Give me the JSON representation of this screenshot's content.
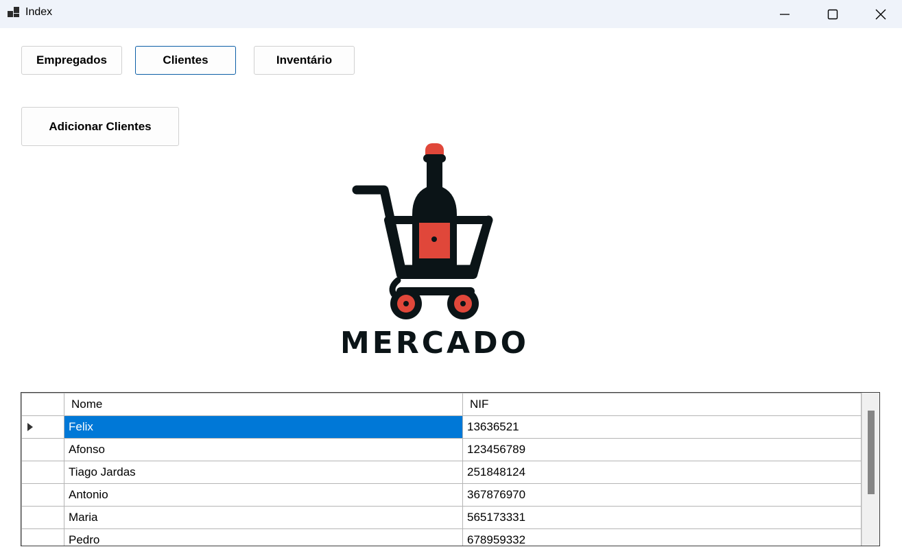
{
  "window": {
    "title": "Index",
    "icon": "app-window-icon"
  },
  "nav": {
    "empregados": "Empregados",
    "clientes": "Clientes",
    "inventario": "Inventário"
  },
  "actions": {
    "add_clients": "Adicionar Clientes"
  },
  "logo": {
    "text": "MERCADO",
    "dark_color": "#0b1417",
    "accent_color": "#e0473a"
  },
  "grid": {
    "columns": [
      "Nome",
      "NIF"
    ],
    "selected_color": "#0078d7",
    "rows": [
      {
        "nome": "Felix",
        "nif": "13636521"
      },
      {
        "nome": "Afonso",
        "nif": "123456789"
      },
      {
        "nome": "Tiago Jardas",
        "nif": "251848124"
      },
      {
        "nome": "Antonio",
        "nif": "367876970"
      },
      {
        "nome": "Maria",
        "nif": "565173331"
      },
      {
        "nome": "Pedro",
        "nif": "678959332"
      }
    ]
  }
}
